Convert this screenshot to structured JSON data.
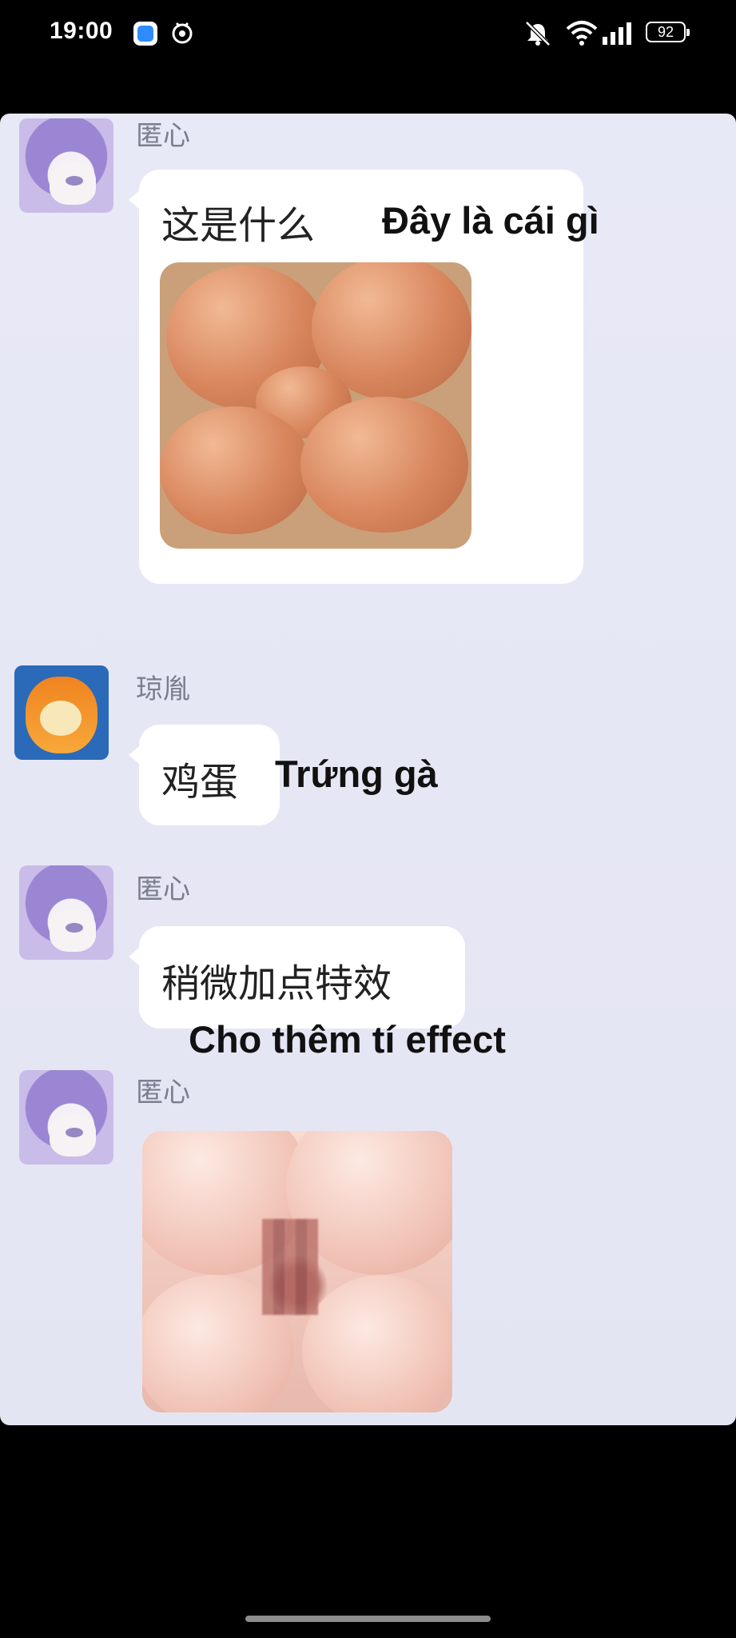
{
  "status_bar": {
    "time": "19:00",
    "battery": "92",
    "icons": [
      "app-icon-blue",
      "app-icon-swirl",
      "mute-bell-icon",
      "wifi-icon",
      "signal-icon",
      "battery-icon"
    ]
  },
  "chat": {
    "messages": [
      {
        "sender": "匿心",
        "text": "这是什么",
        "translation": "Đây là cái gì",
        "attachment": "eggs-photo"
      },
      {
        "sender": "琼胤",
        "text": "鸡蛋",
        "translation": "Trứng gà"
      },
      {
        "sender": "匿心",
        "text": "稍微加点特效",
        "translation": "Cho thêm tí effect"
      },
      {
        "sender": "匿心",
        "attachment": "pixelated-photo"
      }
    ]
  },
  "colors": {
    "chat_bg": "#e6e7f5",
    "bubble": "#ffffff",
    "name": "#7b7e8e",
    "screen_bg": "#000000"
  }
}
